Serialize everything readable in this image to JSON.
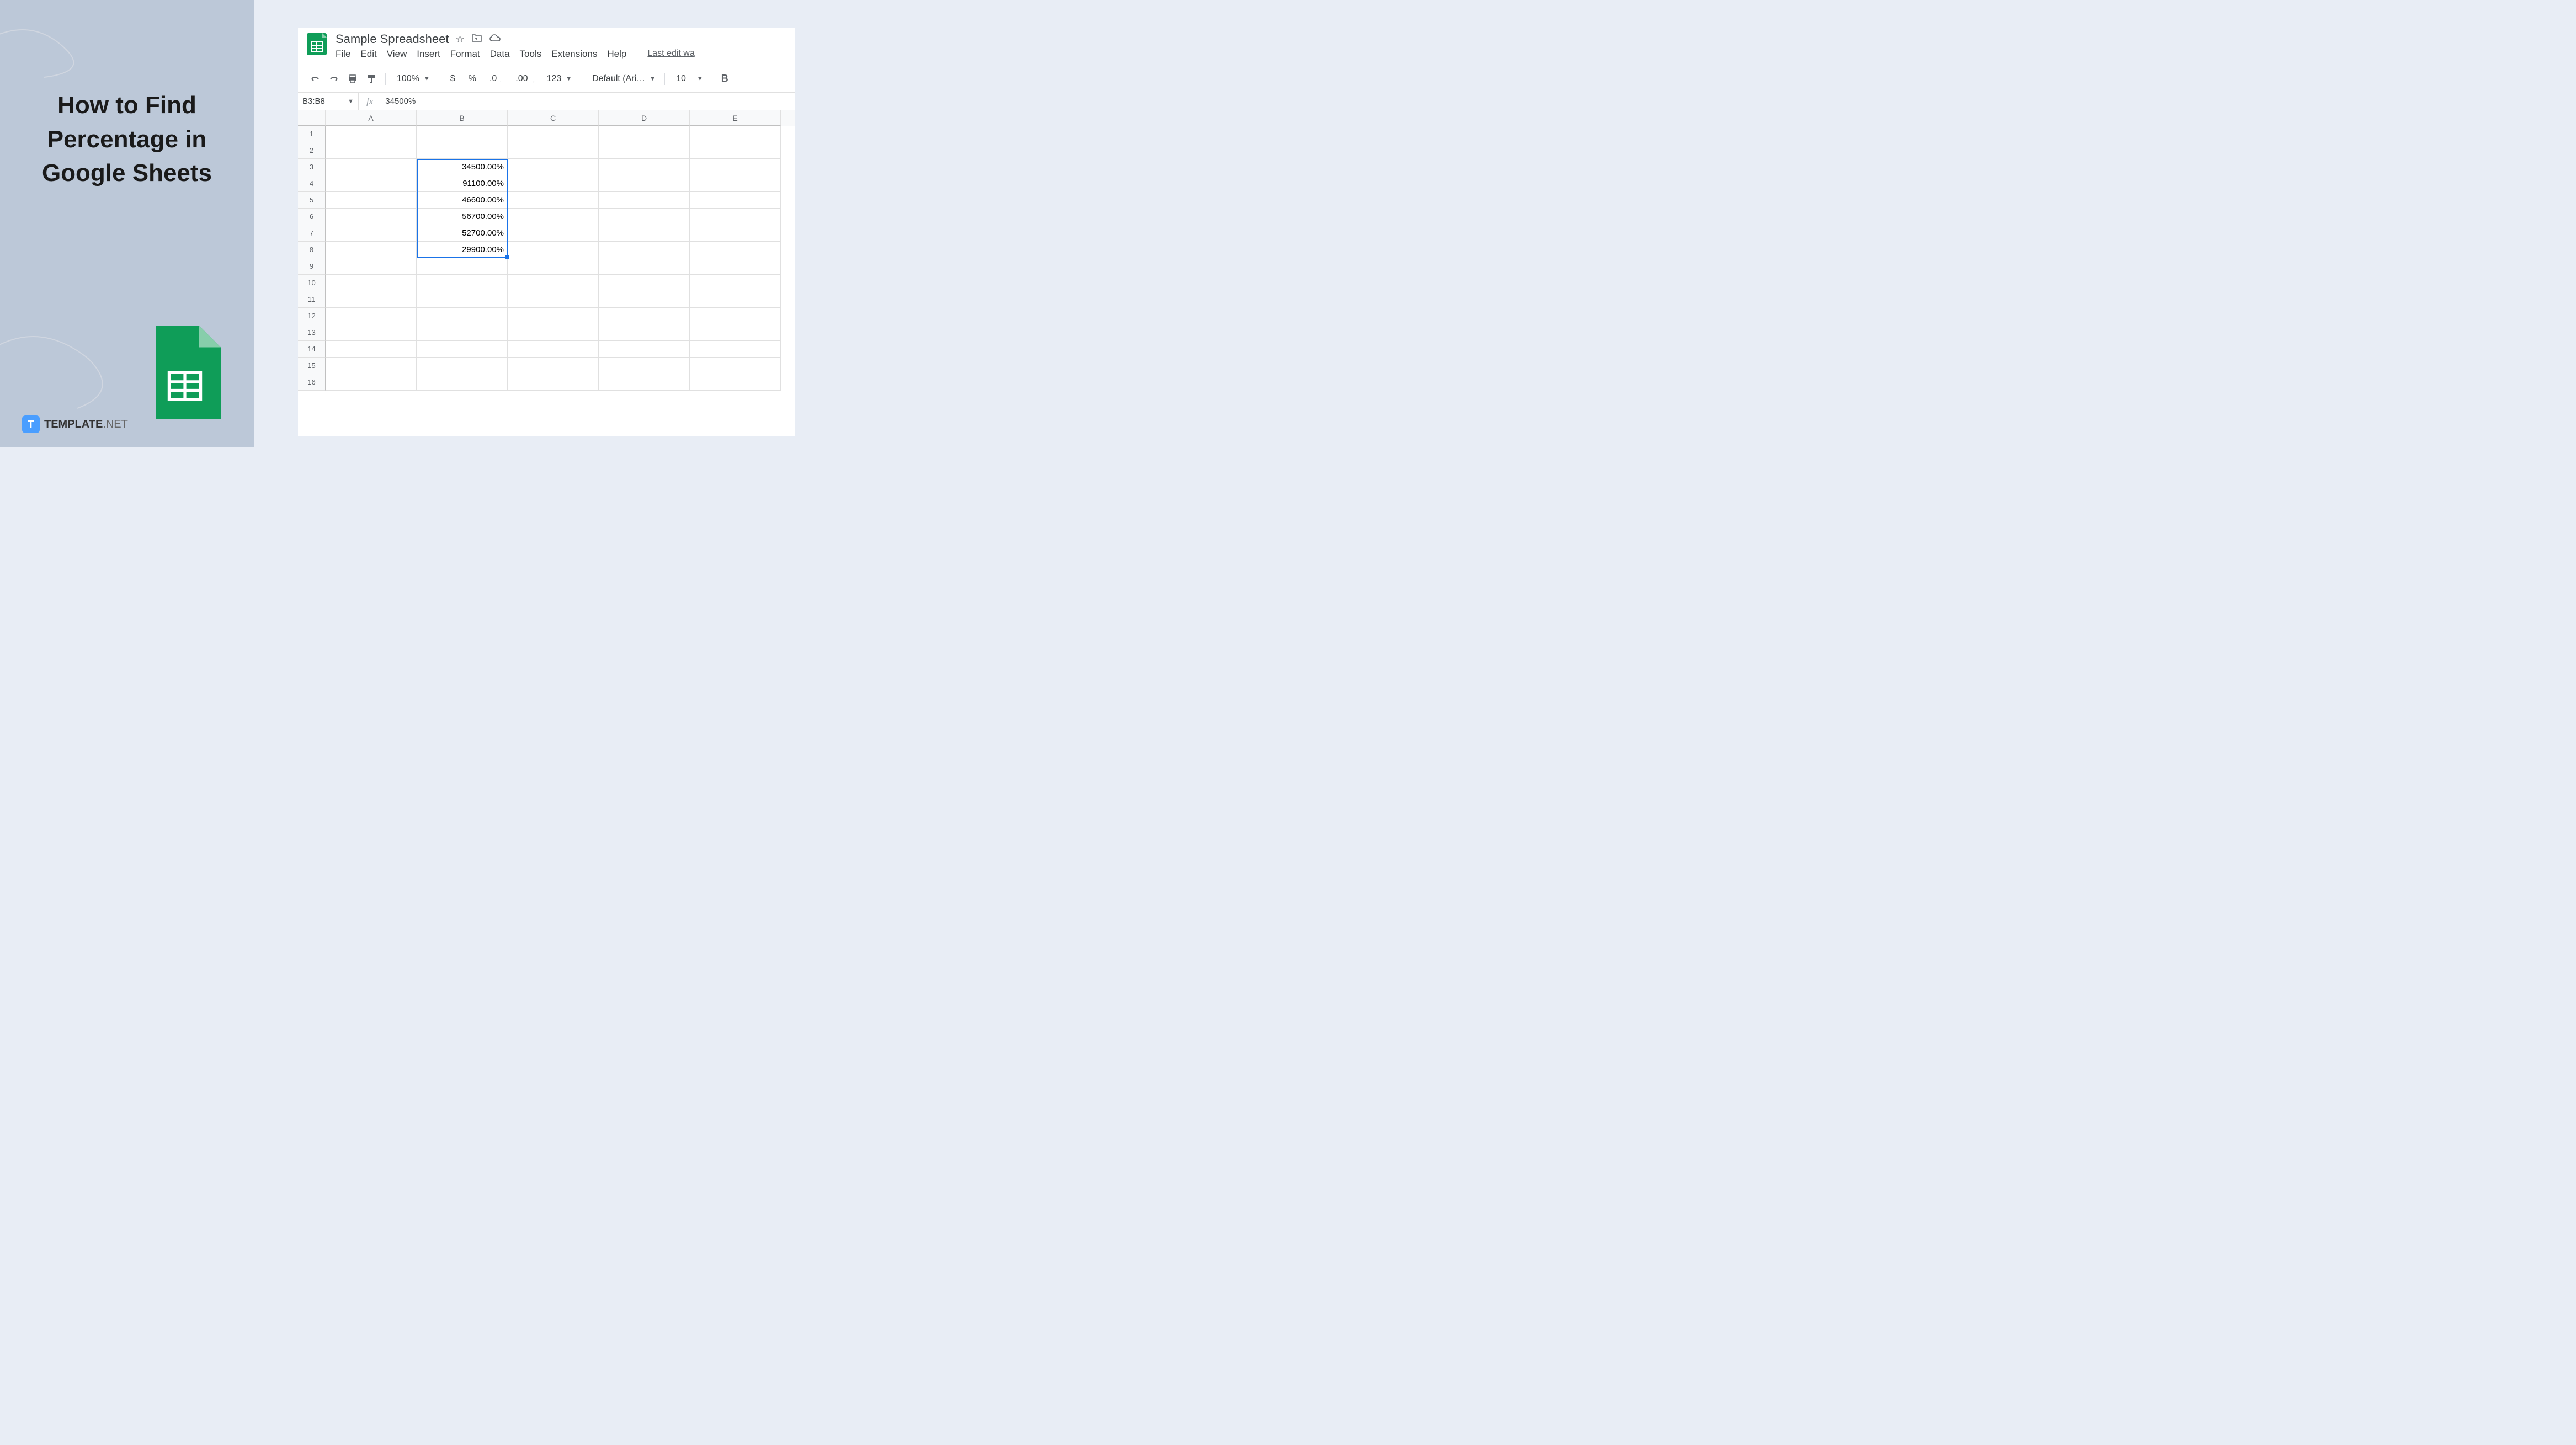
{
  "leftPanel": {
    "title": "How to Find Percentage in Google Sheets",
    "logoText": "TEMPLATE",
    "logoSuffix": ".NET"
  },
  "header": {
    "docTitle": "Sample Spreadsheet",
    "lastEdit": "Last edit wa"
  },
  "menu": {
    "items": [
      "File",
      "Edit",
      "View",
      "Insert",
      "Format",
      "Data",
      "Tools",
      "Extensions",
      "Help"
    ]
  },
  "toolbar": {
    "zoom": "100%",
    "currency": "$",
    "percent": "%",
    "decDecimal": ".0",
    "incDecimal": ".00",
    "numFormat": "123",
    "font": "Default (Ari…",
    "fontSize": "10",
    "bold": "B"
  },
  "formulaBar": {
    "nameBox": "B3:B8",
    "fx": "fx",
    "value": "34500%"
  },
  "columns": [
    "A",
    "B",
    "C",
    "D",
    "E"
  ],
  "rowCount": 16,
  "cellData": {
    "B3": "34500.00%",
    "B4": "91100.00%",
    "B5": "46600.00%",
    "B6": "56700.00%",
    "B7": "52700.00%",
    "B8": "29900.00%"
  },
  "selection": {
    "col": "B",
    "startRow": 3,
    "endRow": 8
  }
}
